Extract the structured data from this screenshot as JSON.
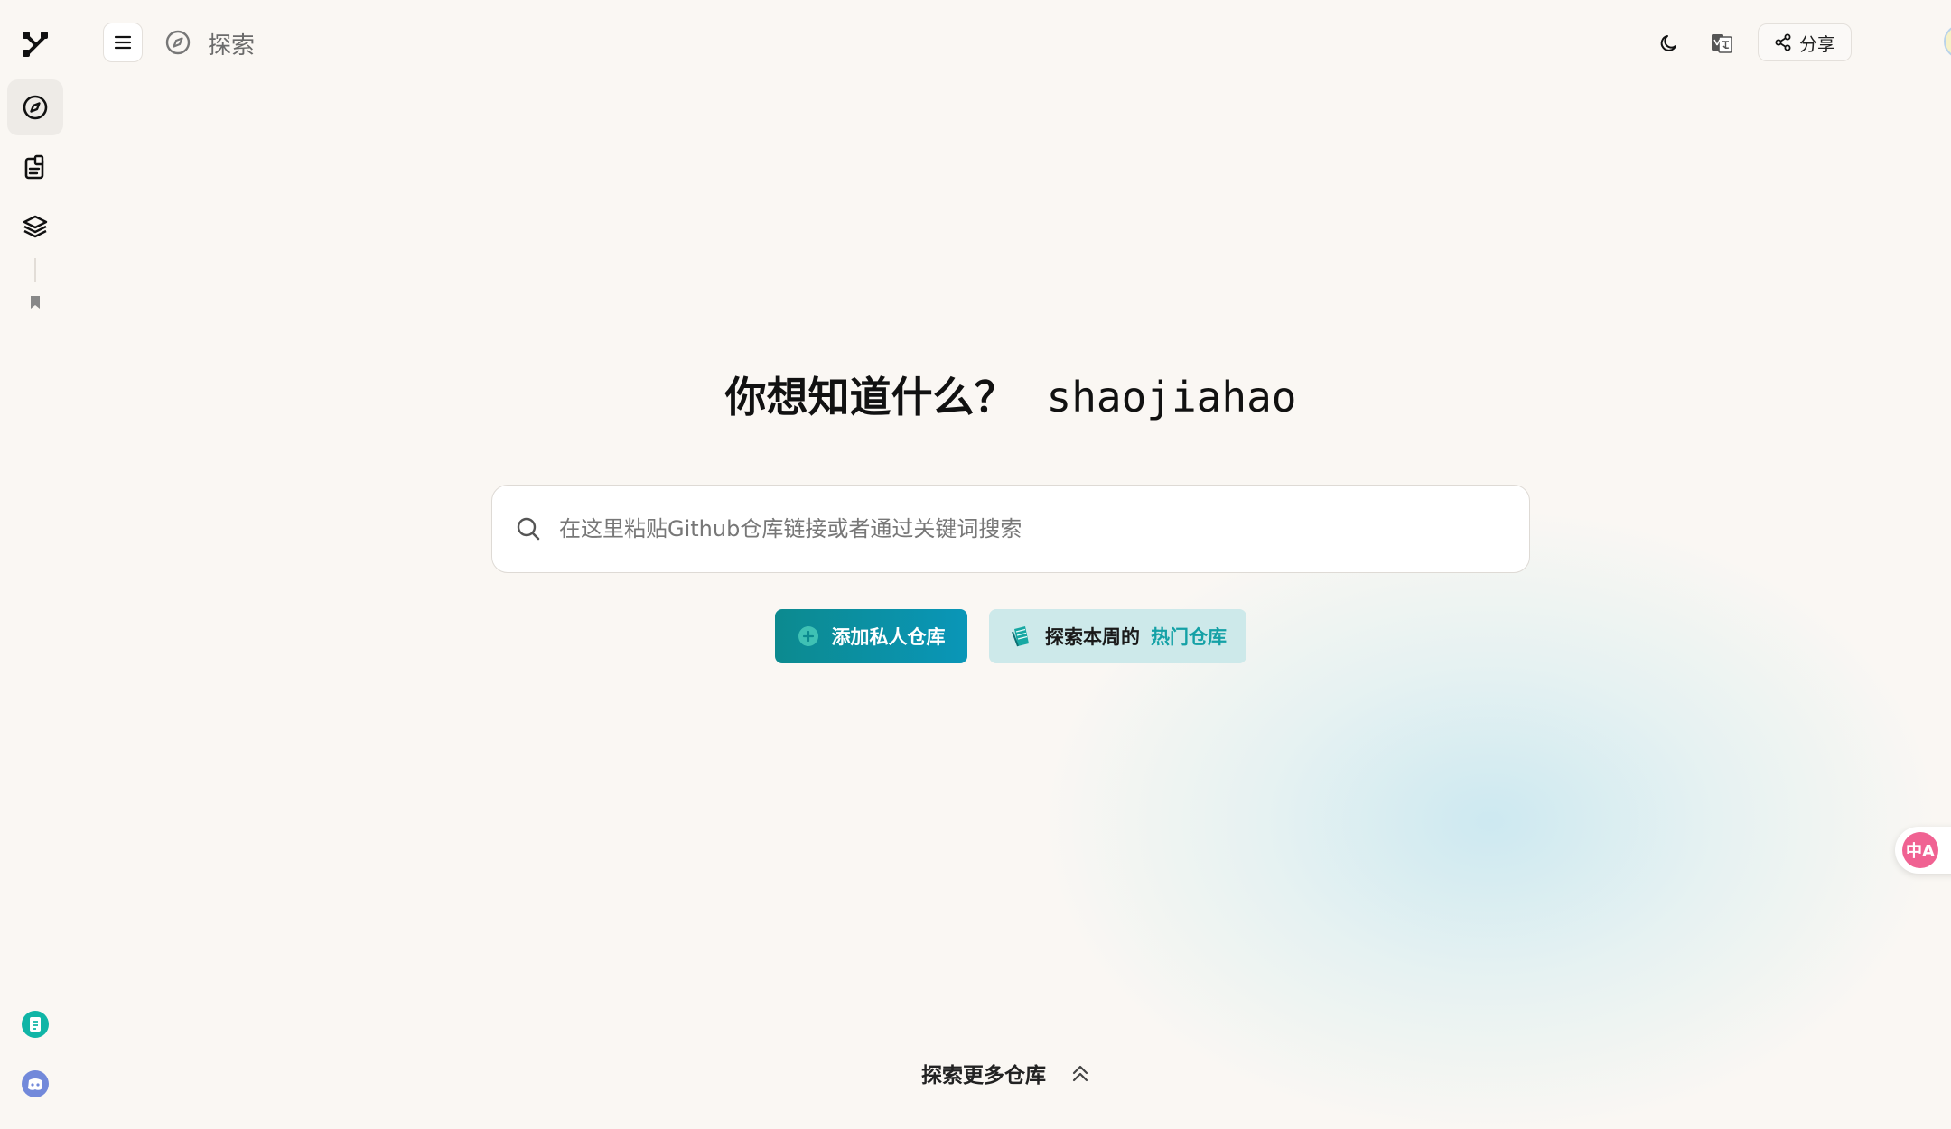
{
  "sidebar": {
    "items": [
      {
        "icon": "logo-icon"
      },
      {
        "icon": "compass-icon",
        "active": true
      },
      {
        "icon": "clipboard-icon"
      },
      {
        "icon": "layers-icon"
      },
      {
        "icon": "bookmark-icon"
      }
    ],
    "bottom": [
      {
        "icon": "doc-icon",
        "color": "#10b5a6"
      },
      {
        "icon": "discord-icon",
        "color": "#7289da"
      }
    ]
  },
  "header": {
    "breadcrumb_label": "探索",
    "share_label": "分享"
  },
  "hero": {
    "title": "你想知道什么？",
    "username": "shaojiahao"
  },
  "search": {
    "placeholder": "在这里粘贴Github仓库链接或者通过关键词搜索",
    "value": ""
  },
  "actions": {
    "add_private_label": "添加私人仓库",
    "explore_week_label": "探索本周的",
    "hot_label": "热门仓库"
  },
  "footer": {
    "explore_more_label": "探索更多仓库"
  },
  "floating": {
    "translate_label": "中A"
  },
  "colors": {
    "accent": "#0c8a8f",
    "accent_light": "#cde9ea",
    "hot_text": "#14a1a6",
    "background": "#faf7f3"
  }
}
